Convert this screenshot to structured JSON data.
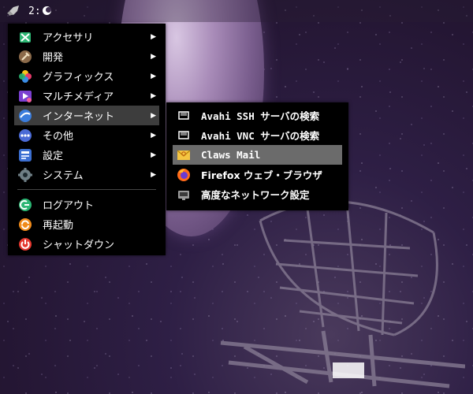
{
  "panel": {
    "workspace_label": "2:"
  },
  "main_menu": {
    "items": [
      {
        "label": "アクセサリ",
        "has_submenu": true,
        "icon": "accessories-icon"
      },
      {
        "label": "開発",
        "has_submenu": true,
        "icon": "development-icon"
      },
      {
        "label": "グラフィックス",
        "has_submenu": true,
        "icon": "graphics-icon"
      },
      {
        "label": "マルチメディア",
        "has_submenu": true,
        "icon": "multimedia-icon"
      },
      {
        "label": "インターネット",
        "has_submenu": true,
        "icon": "internet-icon",
        "active": true
      },
      {
        "label": "その他",
        "has_submenu": true,
        "icon": "other-icon"
      },
      {
        "label": "設定",
        "has_submenu": true,
        "icon": "settings-icon"
      },
      {
        "label": "システム",
        "has_submenu": true,
        "icon": "system-icon"
      }
    ],
    "session": [
      {
        "label": "ログアウト",
        "icon": "logout-icon"
      },
      {
        "label": "再起動",
        "icon": "reboot-icon"
      },
      {
        "label": "シャットダウン",
        "icon": "shutdown-icon"
      }
    ],
    "arrow": "▶"
  },
  "internet_submenu": {
    "items": [
      {
        "label": "Avahi SSH サーバの検索",
        "icon": "network-icon"
      },
      {
        "label": "Avahi VNC サーバの検索",
        "icon": "network-icon"
      },
      {
        "label": "Claws Mail",
        "icon": "mail-icon",
        "highlighted": true
      },
      {
        "label": "Firefox ウェブ・ブラウザ",
        "icon": "firefox-icon"
      },
      {
        "label": "高度なネットワーク設定",
        "icon": "network-settings-icon"
      }
    ]
  },
  "colors": {
    "menu_bg": "#000000",
    "active_bg": "#3d3d3d",
    "highlight_bg": "#6b6b6b",
    "text": "#ffffff"
  }
}
